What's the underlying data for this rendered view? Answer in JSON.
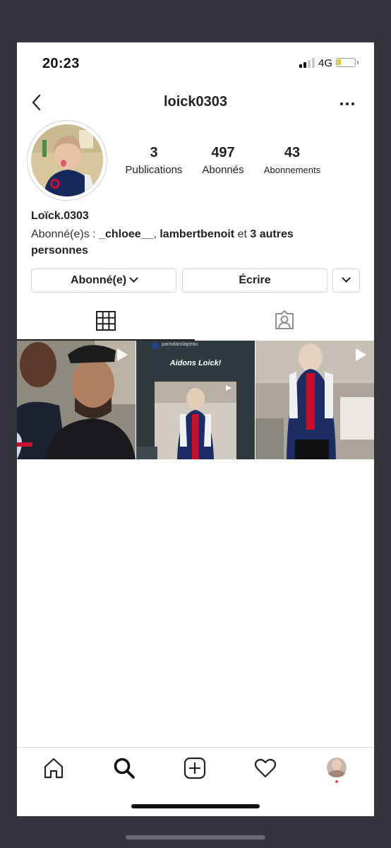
{
  "status_bar": {
    "time": "20:23",
    "network": "4G"
  },
  "header": {
    "username": "loick0303"
  },
  "stats": [
    {
      "value": "3",
      "label": "Publications"
    },
    {
      "value": "497",
      "label": "Abonnés"
    },
    {
      "value": "43",
      "label": "Abonnements"
    }
  ],
  "profile": {
    "display_name": "Loïck.0303",
    "followed_by_prefix": "Abonné(e)s : ",
    "followed_by_user1": "_chloee__",
    "followed_by_sep": ", ",
    "followed_by_user2": "lambertbenoit",
    "followed_by_and": " et ",
    "followed_by_rest": "3 autres personnes"
  },
  "actions": {
    "following_label": "Abonné(e)",
    "message_label": "Écrire"
  },
  "tabs": [
    "grid-icon",
    "tagged-icon"
  ],
  "posts": [
    {
      "type": "video"
    },
    {
      "type": "video",
      "account": "parisdanslapeau",
      "caption": "Aidons Loick!"
    },
    {
      "type": "video"
    }
  ],
  "bottom_nav": [
    "home-icon",
    "search-icon",
    "new-post-icon",
    "activity-icon",
    "profile-icon"
  ]
}
